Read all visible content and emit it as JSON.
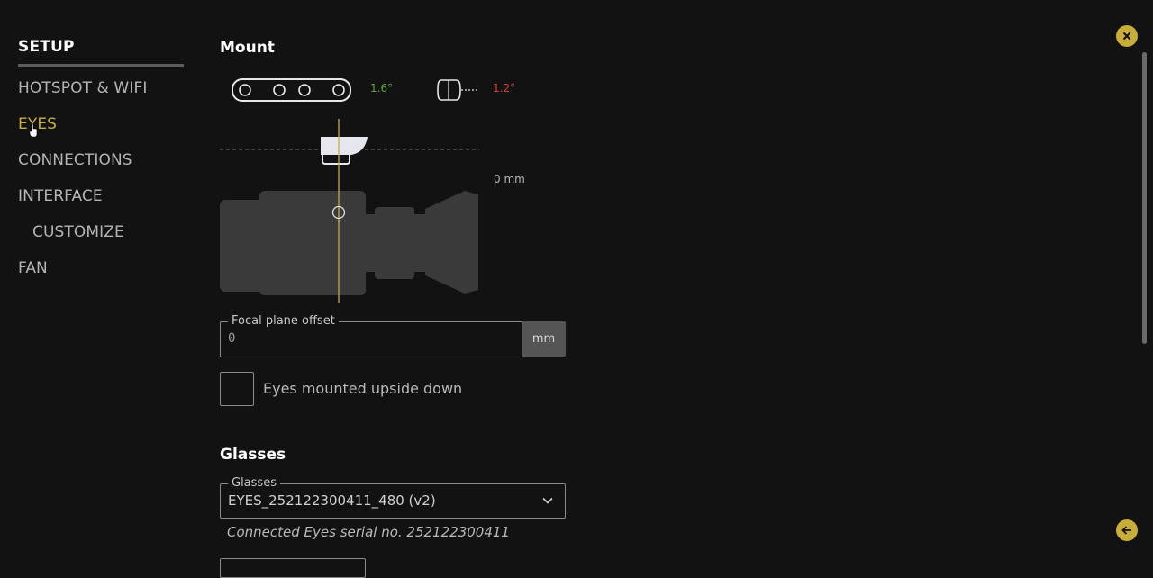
{
  "sidebar": {
    "title": "SETUP",
    "items": [
      {
        "label": "HOTSPOT & WIFI"
      },
      {
        "label": "EYES"
      },
      {
        "label": "CONNECTIONS"
      },
      {
        "label": "INTERFACE"
      },
      {
        "label": "CUSTOMIZE"
      },
      {
        "label": "FAN"
      }
    ],
    "active_item": "EYES"
  },
  "mount": {
    "heading": "Mount",
    "tilt_angle": "1.6°",
    "roll_angle": "1.2°",
    "offset_readout": "0 mm",
    "tilt_color": "#5ea33b",
    "roll_color": "#d2452c"
  },
  "focal_plane": {
    "label": "Focal plane offset",
    "value": "0",
    "unit": "mm"
  },
  "upside_down": {
    "label": "Eyes mounted upside down",
    "checked": false
  },
  "glasses": {
    "heading": "Glasses",
    "field_label": "Glasses",
    "selected": "EYES_252122300411_480 (v2)",
    "serial_note": "Connected Eyes serial no. 252122300411"
  },
  "icons": {
    "close": "close-icon",
    "back": "arrow-left-icon",
    "chevron": "chevron-down-icon"
  },
  "colors": {
    "accent": "#c8ad3a",
    "background": "#121212"
  }
}
